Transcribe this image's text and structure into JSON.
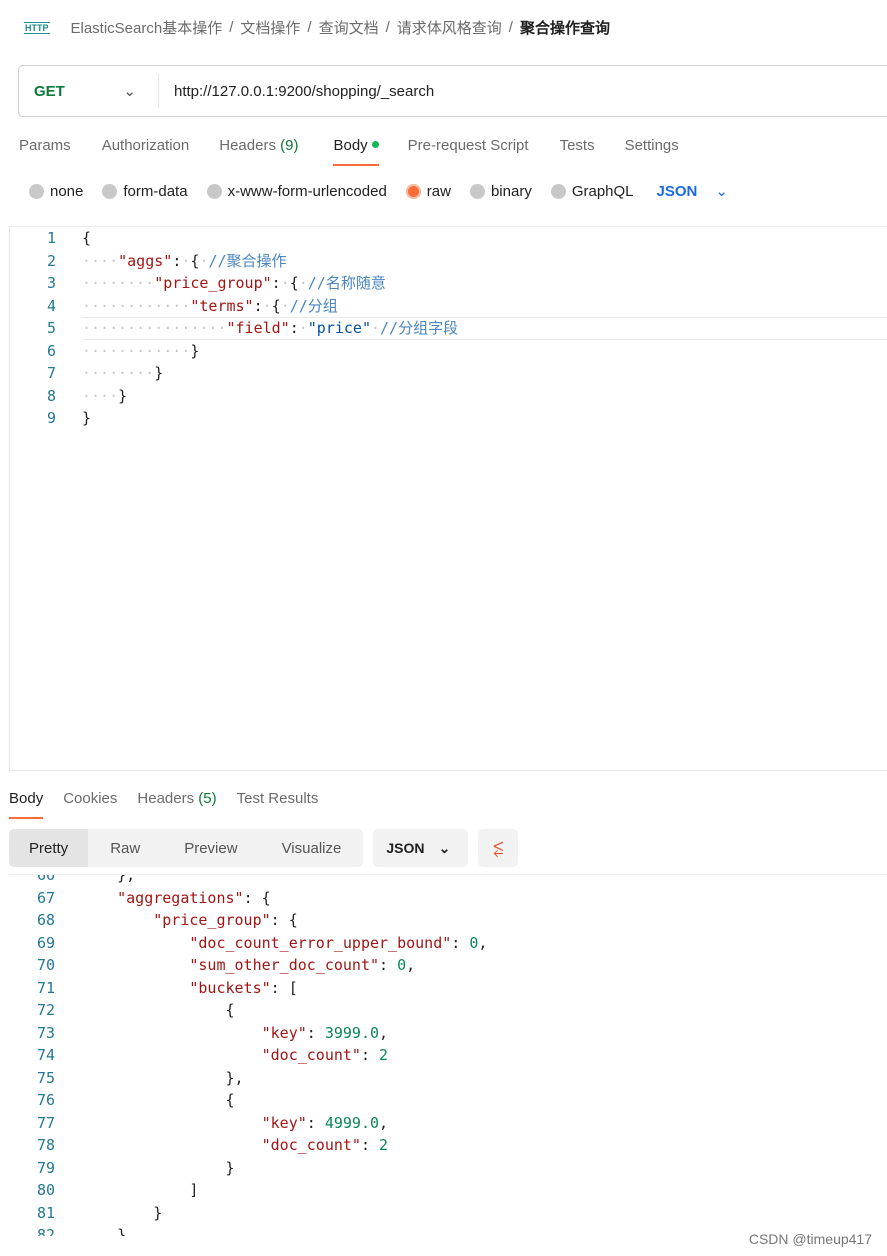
{
  "breadcrumb": {
    "icon": "http-icon",
    "items": [
      "ElasticSearch基本操作",
      "文档操作",
      "查询文档",
      "请求体风格查询"
    ],
    "current": "聚合操作查询",
    "sep": "/"
  },
  "request": {
    "method": "GET",
    "url": "http://127.0.0.1:9200/shopping/_search"
  },
  "request_tabs": [
    {
      "label": "Params"
    },
    {
      "label": "Authorization"
    },
    {
      "label": "Headers",
      "count": "(9)"
    },
    {
      "label": "Body",
      "active": true,
      "dot": true
    },
    {
      "label": "Pre-request Script"
    },
    {
      "label": "Tests"
    },
    {
      "label": "Settings"
    }
  ],
  "body_types": [
    {
      "label": "none"
    },
    {
      "label": "form-data"
    },
    {
      "label": "x-www-form-urlencoded"
    },
    {
      "label": "raw",
      "selected": true
    },
    {
      "label": "binary"
    },
    {
      "label": "GraphQL"
    }
  ],
  "body_format": "JSON",
  "request_body": {
    "start": 1,
    "lines": [
      "{",
      "    \"aggs\": { //聚合操作",
      "        \"price_group\": { //名称随意",
      "            \"terms\": { //分组",
      "                \"field\": \"price\" //分组字段",
      "            }",
      "        }",
      "    }",
      "}"
    ]
  },
  "response_tabs": [
    {
      "label": "Body",
      "active": true
    },
    {
      "label": "Cookies"
    },
    {
      "label": "Headers",
      "count": "(5)"
    },
    {
      "label": "Test Results"
    }
  ],
  "view_modes": [
    "Pretty",
    "Raw",
    "Preview",
    "Visualize"
  ],
  "response_format": "JSON",
  "response_body": {
    "start": 66,
    "lines": [
      "    },",
      "    \"aggregations\": {",
      "        \"price_group\": {",
      "            \"doc_count_error_upper_bound\": 0,",
      "            \"sum_other_doc_count\": 0,",
      "            \"buckets\": [",
      "                {",
      "                    \"key\": 3999.0,",
      "                    \"doc_count\": 2",
      "                },",
      "                {",
      "                    \"key\": 4999.0,",
      "                    \"doc_count\": 2",
      "                }",
      "            ]",
      "        }",
      "    }"
    ]
  },
  "watermark": "CSDN @timeup417",
  "colors": {
    "accent": "#ff6c37",
    "key": "#a31515",
    "string": "#0451a5",
    "number": "#098658",
    "comment": "#4a86c0",
    "method": "#0b7a3b"
  }
}
